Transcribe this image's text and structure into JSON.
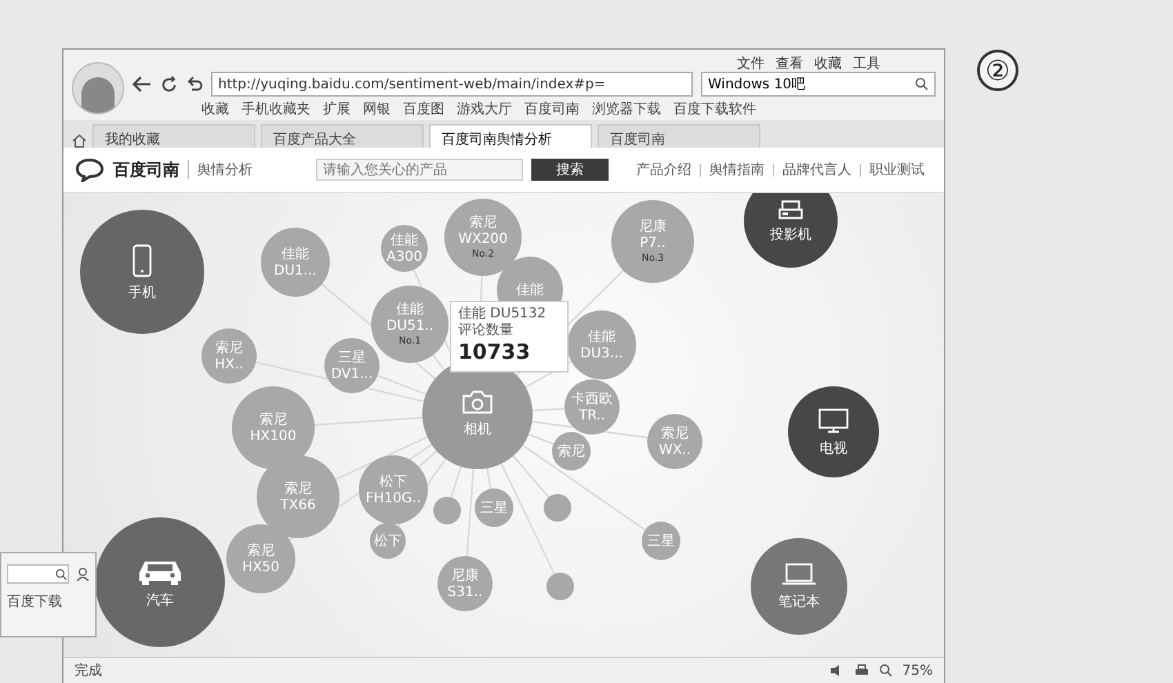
{
  "figure_label": "②",
  "browser": {
    "menu": [
      "文件",
      "查看",
      "收藏",
      "工具"
    ],
    "address": "http://yuqing.baidu.com/sentiment-web/main/index#p=",
    "search": "Windows 10吧",
    "bookmarks": [
      "收藏",
      "手机收藏夹",
      "扩展",
      "网银",
      "百度图",
      "游戏大厅",
      "百度司南",
      "浏览器下载",
      "百度下载软件"
    ],
    "tabs": [
      {
        "label": "我的收藏",
        "selected": false
      },
      {
        "label": "百度产品大全",
        "selected": false
      },
      {
        "label": "百度司南舆情分析",
        "selected": true
      },
      {
        "label": "百度司南",
        "selected": false
      }
    ],
    "status": {
      "left": "完成",
      "zoom": "75%"
    }
  },
  "site": {
    "logo": "百度司南",
    "section": "舆情分析",
    "search_placeholder": "请输入您关心的产品",
    "search_button": "搜索",
    "nav": [
      "产品介绍",
      "舆情指南",
      "品牌代言人",
      "职业测试"
    ]
  },
  "bubbles": [
    {
      "kind": "category",
      "lines": [
        "手机"
      ]
    },
    {
      "kind": "category",
      "lines": [
        "相机"
      ]
    },
    {
      "kind": "category",
      "lines": [
        "投影机"
      ]
    },
    {
      "kind": "category",
      "lines": [
        "电视"
      ]
    },
    {
      "kind": "category",
      "lines": [
        "笔记本"
      ]
    },
    {
      "kind": "category",
      "lines": [
        "汽车"
      ]
    },
    {
      "kind": "product",
      "lines": [
        "佳能",
        "DU1..."
      ]
    },
    {
      "kind": "product",
      "lines": [
        "佳能",
        "A300"
      ]
    },
    {
      "kind": "product",
      "lines": [
        "索尼",
        "WX200",
        "No.2"
      ]
    },
    {
      "kind": "product",
      "lines": [
        "尼康",
        "P7..",
        "No.3"
      ]
    },
    {
      "kind": "product",
      "lines": [
        "佳能",
        "DU51..",
        "No.1"
      ]
    },
    {
      "kind": "product",
      "lines": [
        "佳能"
      ]
    },
    {
      "kind": "product",
      "lines": [
        "佳能",
        "DU3..."
      ]
    },
    {
      "kind": "product",
      "lines": [
        "索尼",
        "HX.."
      ]
    },
    {
      "kind": "product",
      "lines": [
        "三星",
        "DV1..."
      ]
    },
    {
      "kind": "product",
      "lines": [
        "索尼",
        "HX100"
      ]
    },
    {
      "kind": "product",
      "lines": [
        "卡西欧",
        "TR.."
      ]
    },
    {
      "kind": "product",
      "lines": [
        "索尼"
      ]
    },
    {
      "kind": "product",
      "lines": [
        "索尼",
        "WX.."
      ]
    },
    {
      "kind": "product",
      "lines": [
        "索尼",
        "TX66"
      ]
    },
    {
      "kind": "product",
      "lines": [
        "松下",
        "FH10G.."
      ]
    },
    {
      "kind": "product",
      "lines": [
        "索尼",
        "HX50"
      ]
    },
    {
      "kind": "product",
      "lines": [
        "松下"
      ]
    },
    {
      "kind": "dot"
    },
    {
      "kind": "product",
      "lines": [
        "三星"
      ]
    },
    {
      "kind": "dot"
    },
    {
      "kind": "product",
      "lines": [
        "尼康",
        "S31.."
      ]
    },
    {
      "kind": "dot"
    },
    {
      "kind": "product",
      "lines": [
        "三星"
      ]
    }
  ],
  "tooltip": {
    "title": "佳能 DU5132",
    "label": "评论数量",
    "value": "10733"
  },
  "side_window": {
    "bookmark": "百度下载"
  }
}
